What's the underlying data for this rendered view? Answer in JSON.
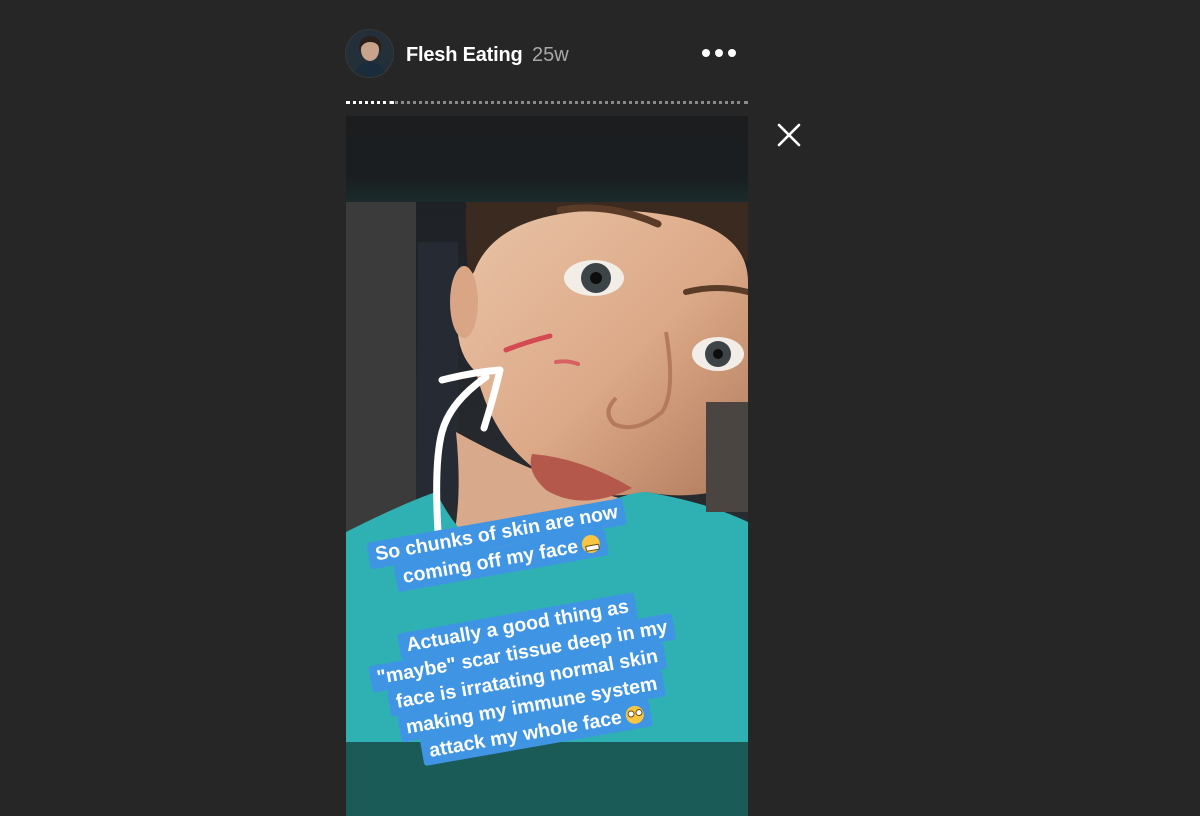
{
  "header": {
    "username": "Flesh Eating",
    "timestamp": "25w",
    "more_icon": "more-horizontal-icon",
    "avatar_icon": "avatar"
  },
  "progress": {
    "segments_viewed_fraction": 0.12
  },
  "close": {
    "icon": "close-icon"
  },
  "story": {
    "caption_1": {
      "lines": [
        "So chunks of skin are now",
        "coming off my face"
      ],
      "emoji": "grimacing-face-emoji"
    },
    "caption_2": {
      "lines": [
        "Actually a good thing as",
        "\"maybe\" scar tissue deep in my",
        "face is irratating normal skin",
        "making my immune system",
        "attack my whole face"
      ],
      "emoji": "face-with-rolling-eyes-emoji"
    },
    "arrow_icon": "white-arrow-drawing"
  },
  "colors": {
    "background": "#262626",
    "caption_highlight": "#3f95e3",
    "text": "#ffffff",
    "timestamp": "#a8a8a8",
    "bottom_band": "#1a5a57"
  }
}
